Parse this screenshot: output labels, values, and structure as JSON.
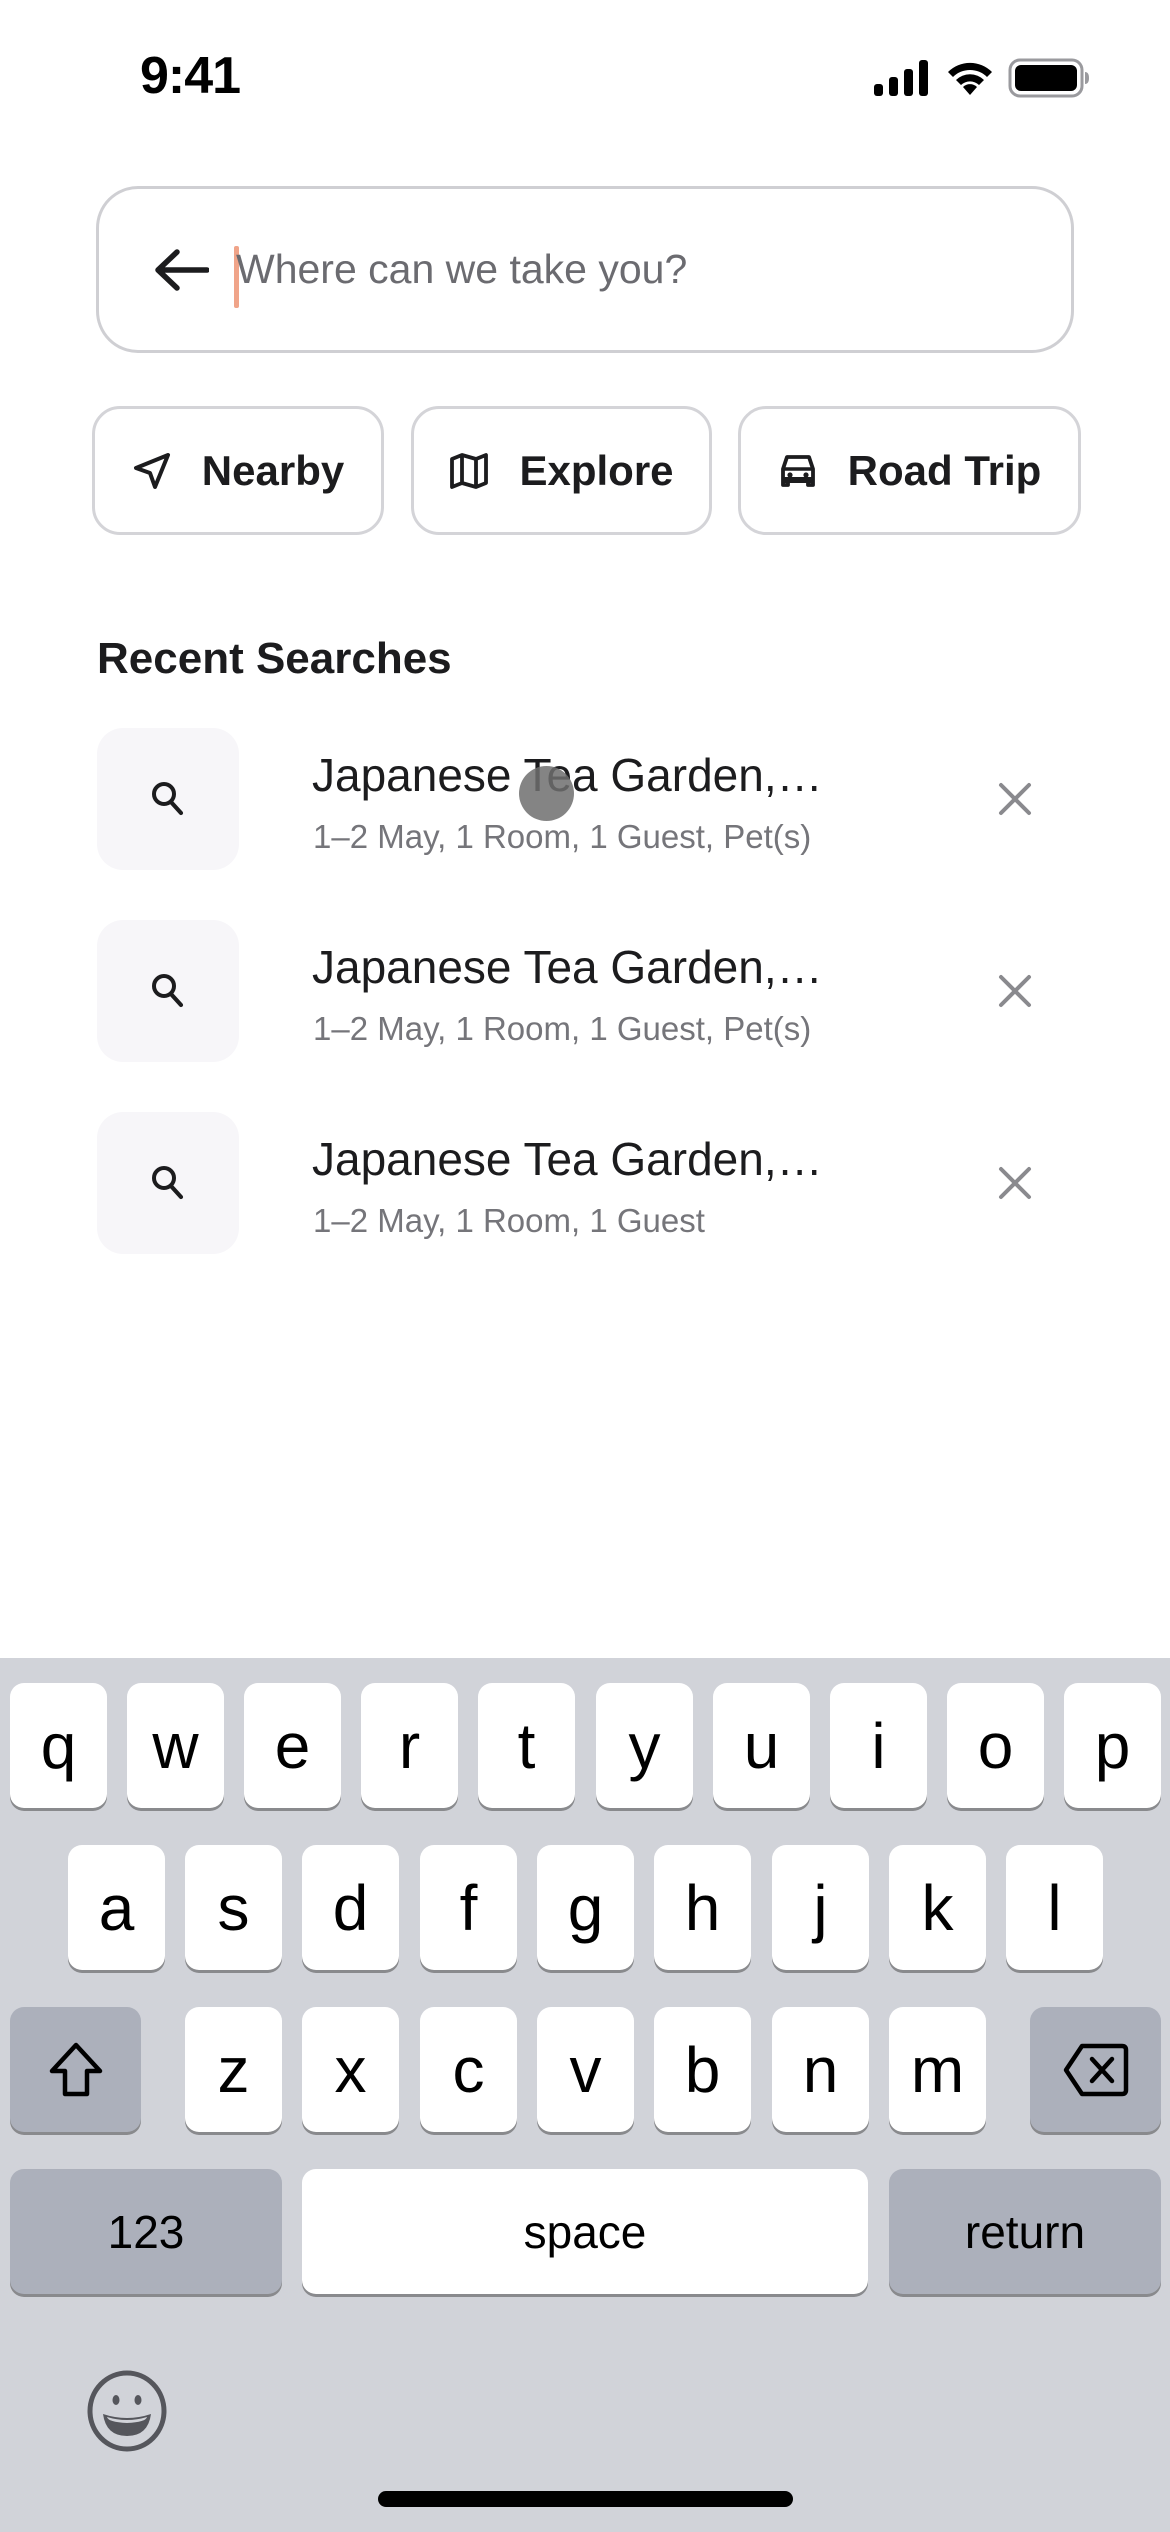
{
  "status_bar": {
    "time": "9:41",
    "icons": [
      "cellular-signal-icon",
      "wifi-icon",
      "battery-icon"
    ]
  },
  "search": {
    "placeholder": "Where can we take you?",
    "value": "",
    "back_icon": "arrow-left-icon",
    "caret_color": "#f0a489"
  },
  "chips": [
    {
      "label": "Nearby",
      "icon": "navigation-arrow-icon"
    },
    {
      "label": "Explore",
      "icon": "map-icon"
    },
    {
      "label": "Road Trip",
      "icon": "car-icon"
    }
  ],
  "recent": {
    "title": "Recent Searches",
    "items": [
      {
        "title": "Japanese Tea Garden,…",
        "subtitle": "1–2 May, 1 Room, 1 Guest, Pet(s)",
        "icon": "search-icon",
        "action_icon": "close-icon"
      },
      {
        "title": "Japanese Tea Garden,…",
        "subtitle": "1–2 May, 1 Room, 1 Guest, Pet(s)",
        "icon": "search-icon",
        "action_icon": "close-icon"
      },
      {
        "title": "Japanese Tea Garden,…",
        "subtitle": "1–2 May, 1 Room, 1 Guest",
        "icon": "search-icon",
        "action_icon": "close-icon"
      }
    ]
  },
  "keyboard": {
    "row1": [
      "q",
      "w",
      "e",
      "r",
      "t",
      "y",
      "u",
      "i",
      "o",
      "p"
    ],
    "row2": [
      "a",
      "s",
      "d",
      "f",
      "g",
      "h",
      "j",
      "k",
      "l"
    ],
    "row3": [
      "z",
      "x",
      "c",
      "v",
      "b",
      "n",
      "m"
    ],
    "shift_icon": "shift-icon",
    "delete_icon": "backspace-icon",
    "numbers_label": "123",
    "space_label": "space",
    "return_label": "return",
    "emoji_icon": "emoji-icon"
  },
  "colors": {
    "keyboard_bg": "#d1d3d9",
    "key_bg": "#ffffff",
    "key_dark_bg": "#acb0bb",
    "icon_box_bg": "#f7f6f9",
    "subtitle_text": "#75757a",
    "border": "#d4d4d8"
  }
}
